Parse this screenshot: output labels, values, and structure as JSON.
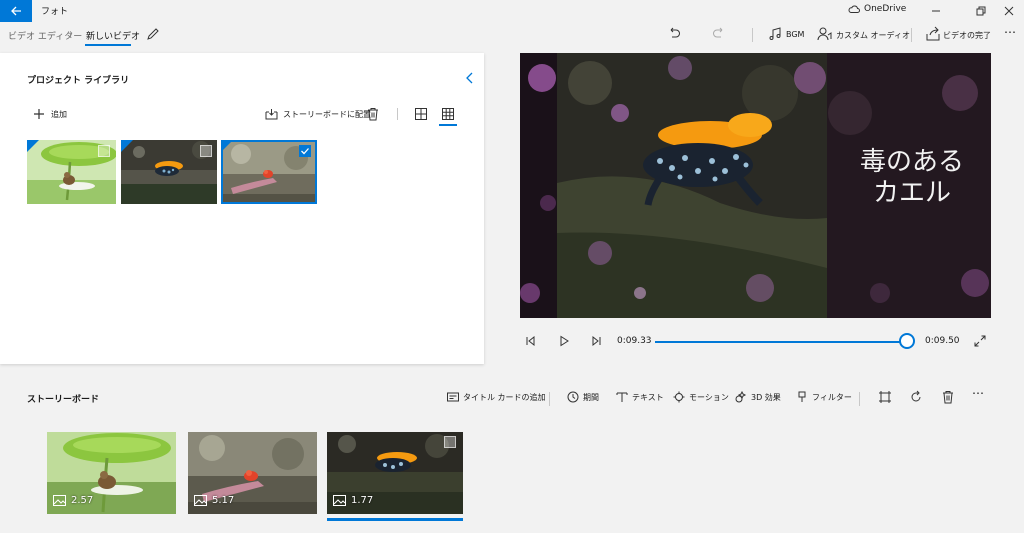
{
  "titlebar": {
    "app_title": "フォト",
    "cloud_label": "OneDrive"
  },
  "breadcrumb": {
    "parent": "ビデオ エディター",
    "current": "新しいビデオ"
  },
  "toolbar": {
    "bgm_label": "BGM",
    "custom_audio_label": "カスタム オーディオ",
    "finish_label": "ビデオの完了"
  },
  "library": {
    "title": "プロジェクト ライブラリ",
    "add_label": "追加",
    "place_label": "ストーリーボードに配置",
    "items": [
      {
        "name": "frog-leaf",
        "checked": false
      },
      {
        "name": "poison-frog",
        "checked": false
      },
      {
        "name": "red-frog",
        "checked": true
      }
    ]
  },
  "preview": {
    "overlay_text_line1": "毒のある",
    "overlay_text_line2": "カエル"
  },
  "player": {
    "current_time": "0:09.33",
    "total_time": "0:09.50",
    "progress": 0.98
  },
  "storyboard": {
    "title": "ストーリーボード",
    "add_title_card": "タイトル カードの追加",
    "duration_label": "期間",
    "text_label": "テキスト",
    "motion_label": "モーション",
    "effects_3d_label": "3D 効果",
    "filter_label": "フィルター",
    "clips": [
      {
        "duration": "2.57"
      },
      {
        "duration": "5.17"
      },
      {
        "duration": "1.77"
      }
    ]
  },
  "colors": {
    "accent": "#0078d7",
    "frog_orange": "#f59a10",
    "panel": "#ffffff",
    "background": "#f2f2f2"
  }
}
